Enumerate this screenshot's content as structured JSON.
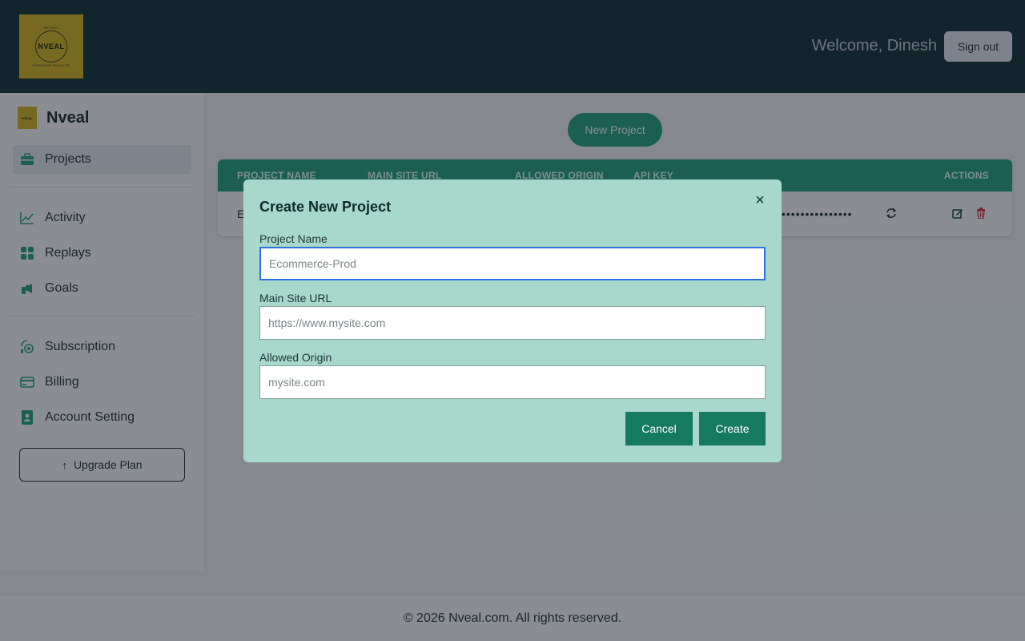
{
  "header": {
    "logo": {
      "top_text": "NEVEAL",
      "text": "NVEAL",
      "sub_text": "WEBSHOP ANALYZE"
    },
    "welcome": "Welcome, Dinesh",
    "signout_label": "Sign out",
    "bg_color": "#0e2a30"
  },
  "sidebar": {
    "brand_name": "Nveal",
    "brand_logo_text": "NVEAL",
    "items": [
      {
        "label": "Projects",
        "icon": "briefcase-icon",
        "active": true
      },
      {
        "label": "Activity",
        "icon": "line-chart-icon",
        "active": false
      },
      {
        "label": "Replays",
        "icon": "grid-icon",
        "active": false
      },
      {
        "label": "Goals",
        "icon": "goal-icon",
        "active": false
      },
      {
        "label": "Subscription",
        "icon": "subscription-icon",
        "active": false
      },
      {
        "label": "Billing",
        "icon": "card-icon",
        "active": false
      },
      {
        "label": "Account Setting",
        "icon": "contact-icon",
        "active": false
      }
    ],
    "upgrade_label": "Upgrade Plan",
    "upgrade_icon": "arrow-up-icon"
  },
  "main": {
    "new_project_label": "New Project",
    "table": {
      "columns": [
        "PROJECT NAME",
        "MAIN SITE URL",
        "ALLOWED ORIGIN",
        "API KEY",
        "ACTIONS"
      ],
      "rows": [
        {
          "name_partial": "E",
          "api_key_masked": "•••••••••••••••"
        }
      ]
    },
    "accent_color": "#20a07e"
  },
  "modal": {
    "title": "Create New Project",
    "close_icon": "close-icon",
    "fields": [
      {
        "label": "Project Name",
        "placeholder": "Ecommerce-Prod",
        "value": ""
      },
      {
        "label": "Main Site URL",
        "placeholder": "https://www.mysite.com",
        "value": ""
      },
      {
        "label": "Allowed Origin",
        "placeholder": "mysite.com",
        "value": ""
      }
    ],
    "cancel_label": "Cancel",
    "create_label": "Create",
    "bg_color": "#a8d8cc",
    "button_color": "#167a60"
  },
  "footer": {
    "text": "© 2026 Nveal.com. All rights reserved."
  }
}
